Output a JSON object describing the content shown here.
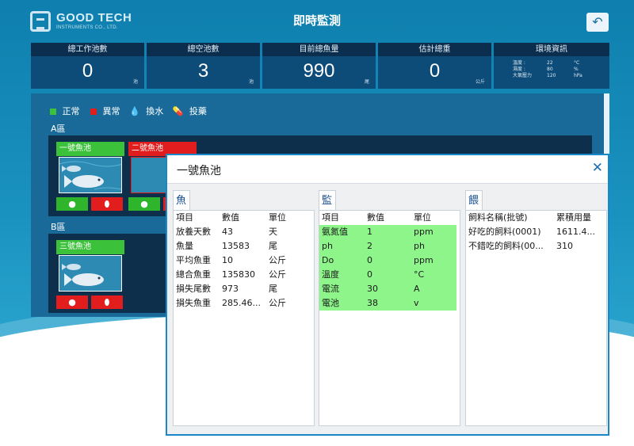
{
  "app": {
    "logo_name": "GOOD TECH",
    "logo_sub": "INSTRUMENTS CO., LTD.",
    "title": "即時監測",
    "back_icon": "back-arrow-icon"
  },
  "stats": [
    {
      "label": "總工作池數",
      "value": "0",
      "unit": "池"
    },
    {
      "label": "總空池數",
      "value": "3",
      "unit": "池"
    },
    {
      "label": "目前總魚量",
      "value": "990",
      "unit": "尾"
    },
    {
      "label": "估計總重",
      "value": "0",
      "unit": "公斤"
    }
  ],
  "environment": {
    "label": "環境資訊",
    "rows": [
      {
        "name": "溫度 :",
        "value": "22",
        "unit": "°C"
      },
      {
        "name": "濕度 :",
        "value": "80",
        "unit": "%"
      },
      {
        "name": "大氣壓力",
        "value": "120",
        "unit": "hPa"
      }
    ]
  },
  "legend": {
    "normal": "正常",
    "abnormal": "異常",
    "water": "換水",
    "medicine": "投藥",
    "colors": {
      "normal": "#3cc13b",
      "abnormal": "#e11d1d"
    }
  },
  "areas": [
    {
      "label": "A區",
      "ponds": [
        {
          "name": "一號魚池",
          "status": "normal"
        },
        {
          "name": "二號魚池",
          "status": "abnormal"
        }
      ]
    },
    {
      "label": "B區",
      "ponds": [
        {
          "name": "三號魚池",
          "status": "normal"
        }
      ]
    }
  ],
  "modal": {
    "title": "一號魚池",
    "close_icon": "close-icon",
    "pond_info": {
      "title": "魚池資訊",
      "headers": [
        "項目",
        "數值",
        "單位"
      ],
      "rows": [
        [
          "放養天數",
          "43",
          "天"
        ],
        [
          "魚量",
          "13583",
          "尾"
        ],
        [
          "平均魚重",
          "10",
          "公斤"
        ],
        [
          "總合魚重",
          "135830",
          "公斤"
        ],
        [
          "損失尾數",
          "973",
          "尾"
        ],
        [
          "損失魚重",
          "285.46...",
          "公斤"
        ]
      ]
    },
    "monitor_info": {
      "title": "監測資訊",
      "headers": [
        "項目",
        "數值",
        "單位"
      ],
      "rows": [
        [
          "氨氮值",
          "1",
          "ppm"
        ],
        [
          "ph",
          "2",
          "ph"
        ],
        [
          "Do",
          "0",
          "ppm"
        ],
        [
          "溫度",
          "0",
          "°C"
        ],
        [
          "電流",
          "30",
          "A"
        ],
        [
          "電池",
          "38",
          "v"
        ]
      ]
    },
    "feed_info": {
      "title": "餵料資訊",
      "headers": [
        "飼料名稱(批號)",
        "累積用量"
      ],
      "rows": [
        [
          "好吃的飼料(0001)",
          "1611.4..."
        ],
        [
          "不錯吃的飼料(00...",
          "310"
        ]
      ]
    }
  }
}
